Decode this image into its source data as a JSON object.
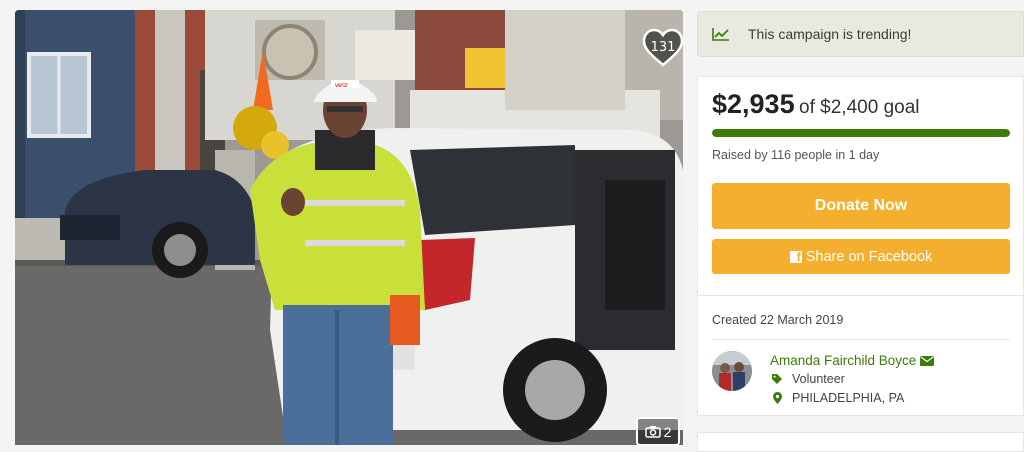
{
  "photo": {
    "heart_count": "131",
    "photo_count": "2",
    "hardhat_text": "veriz"
  },
  "trending": {
    "text": "This campaign is trending!",
    "icon": "trending-chart-icon"
  },
  "donation": {
    "raised_amount": "$2,935",
    "goal_text": "of $2,400 goal",
    "progress_percent": 100,
    "raised_by_text": "Raised by 116 people in 1 day",
    "donate_label": "Donate Now",
    "share_label": "Share on Facebook"
  },
  "details": {
    "created_text": "Created 22 March 2019",
    "organizer_name": "Amanda Fairchild Boyce",
    "organizer_role": "Volunteer",
    "location": "PHILADELPHIA, PA"
  },
  "colors": {
    "accent": "#f5af2e",
    "progress": "#3d7b09",
    "organizer_link": "#3d7b09",
    "trend_bg": "#e9eadf"
  }
}
